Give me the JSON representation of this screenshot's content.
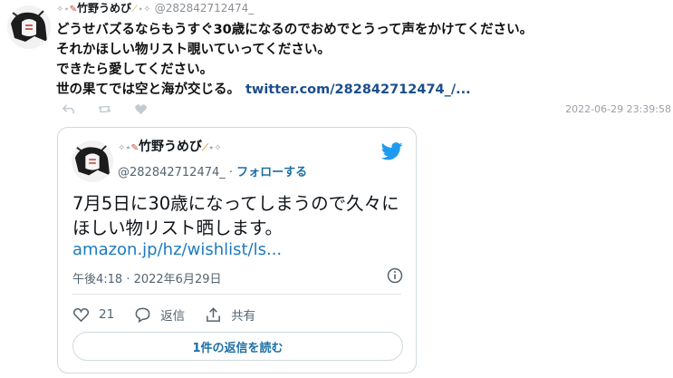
{
  "tweet": {
    "author_name": "竹野うめび",
    "author_handle": "@282842712474_",
    "lines": [
      "どうせバズるならもうすぐ30歳になるのでおめでとうって声をかけてください。",
      "それかほしい物リスト覗いていってください。",
      "できたら愛してください。",
      "世の果てでは空と海が交じる。"
    ],
    "link": "twitter.com/282842712474_/...",
    "timestamp": "2022-06-29 23:39:58",
    "action_icons": [
      "reply-icon",
      "retweet-icon",
      "like-icon"
    ]
  },
  "quoted": {
    "author_name": "竹野うめび",
    "author_handle": "@282842712474_",
    "separator": " · ",
    "follow_label": "フォローする",
    "text_lines": [
      "7月5日に30歳になってしまうので久々に",
      "ほしい物リスト晒します。"
    ],
    "link": "amazon.jp/hz/wishlist/ls...",
    "time": "午後4:18 · 2022年6月29日",
    "like_count": "21",
    "reply_label": "返信",
    "share_label": "共有",
    "read_replies_label": "1件の返信を読む"
  },
  "colors": {
    "link_dark": "#1b4e8c",
    "link": "#1d7bc0",
    "twitter_blue": "#1d9bf0",
    "border": "#cfd9de"
  }
}
